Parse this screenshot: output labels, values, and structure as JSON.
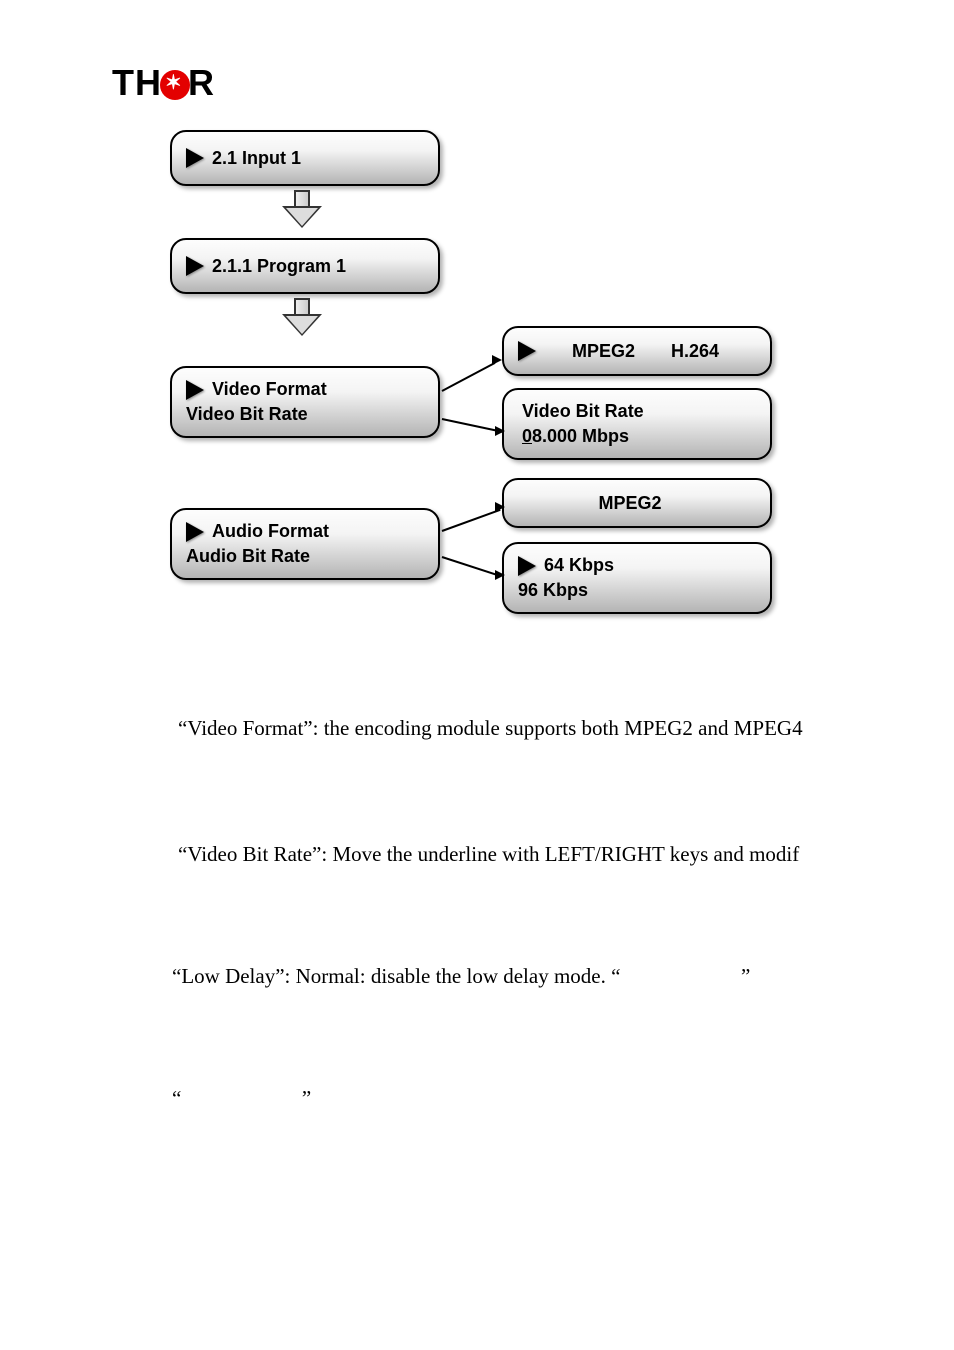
{
  "logo": {
    "part1": "TH",
    "part2": "R"
  },
  "diagram": {
    "b1": "2.1 Input  1",
    "b2": "2.1.1 Program 1",
    "b3a": "Video Format",
    "b3b": "Video Bit Rate",
    "b4": {
      "opt1": "MPEG2",
      "opt2": "H.264"
    },
    "b5a": "Video Bit Rate",
    "b5b_prefix": "0",
    "b5b_rest": "8.000 Mbps",
    "b6a": "Audio Format",
    "b6b": "Audio Bit Rate",
    "b7": "MPEG2",
    "b8a": "64 Kbps",
    "b8b": "96 Kbps"
  },
  "para1": "“Video Format”: the encoding module supports both MPEG2 and MPEG4",
  "para2": "“Video Bit Rate”: Move the underline with LEFT/RIGHT keys and modif",
  "para3a": "“Low Delay”: Normal: disable the low delay mode. “",
  "para3b": "”",
  "para4a": "“",
  "para4b": "”"
}
